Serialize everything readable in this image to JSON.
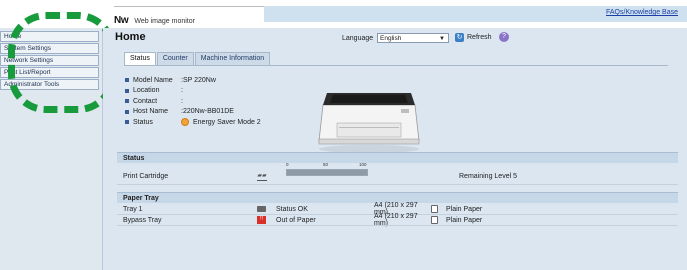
{
  "header": {
    "brand_model": "Nw",
    "brand_subtitle": "Web image monitor",
    "faq_link": "FAQs/Knowledge Base"
  },
  "sidebar": {
    "items": [
      {
        "label": "Home"
      },
      {
        "label": "System Settings"
      },
      {
        "label": "Network Settings"
      },
      {
        "label": "Print List/Report"
      },
      {
        "label": "Administrator Tools"
      }
    ]
  },
  "main": {
    "title": "Home",
    "language_label": "Language",
    "language_value": "English",
    "refresh_label": "Refresh",
    "tabs": [
      {
        "label": "Status",
        "active": true
      },
      {
        "label": "Counter",
        "active": false
      },
      {
        "label": "Machine Information",
        "active": false
      }
    ],
    "info": [
      {
        "label": "Model Name",
        "value": ":SP 220Nw"
      },
      {
        "label": "Location",
        "value": ":"
      },
      {
        "label": "Contact",
        "value": ":"
      },
      {
        "label": "Host Name",
        "value": ":220Nw-BB01DE"
      },
      {
        "label": "Status",
        "value": "Energy Saver Mode 2"
      }
    ]
  },
  "status_section": {
    "title": "Status",
    "cartridge_label": "Print Cartridge",
    "gauge_ticks": [
      "0",
      "50",
      "100"
    ],
    "gauge_level_percent": 100,
    "remaining_text": "Remaining Level 5"
  },
  "paper_section": {
    "title": "Paper Tray",
    "trays": [
      {
        "name": "Tray 1",
        "status": "Status OK",
        "size": "A4 (210 x 297 mm)",
        "type": "Plain Paper"
      },
      {
        "name": "Bypass Tray",
        "status": "Out of Paper",
        "size": "A4 (210 x 297 mm)",
        "type": "Plain Paper"
      }
    ]
  },
  "colors": {
    "annotation_outline": "#189b3c",
    "panel_bg": "#dbe6f1",
    "link": "#1a3fa8"
  },
  "icons": [
    "refresh-icon",
    "help-icon",
    "energy-saver-icon",
    "printer-image",
    "ink-cartridge-icon",
    "tray-ok-icon",
    "tray-error-icon",
    "paper-icon"
  ]
}
